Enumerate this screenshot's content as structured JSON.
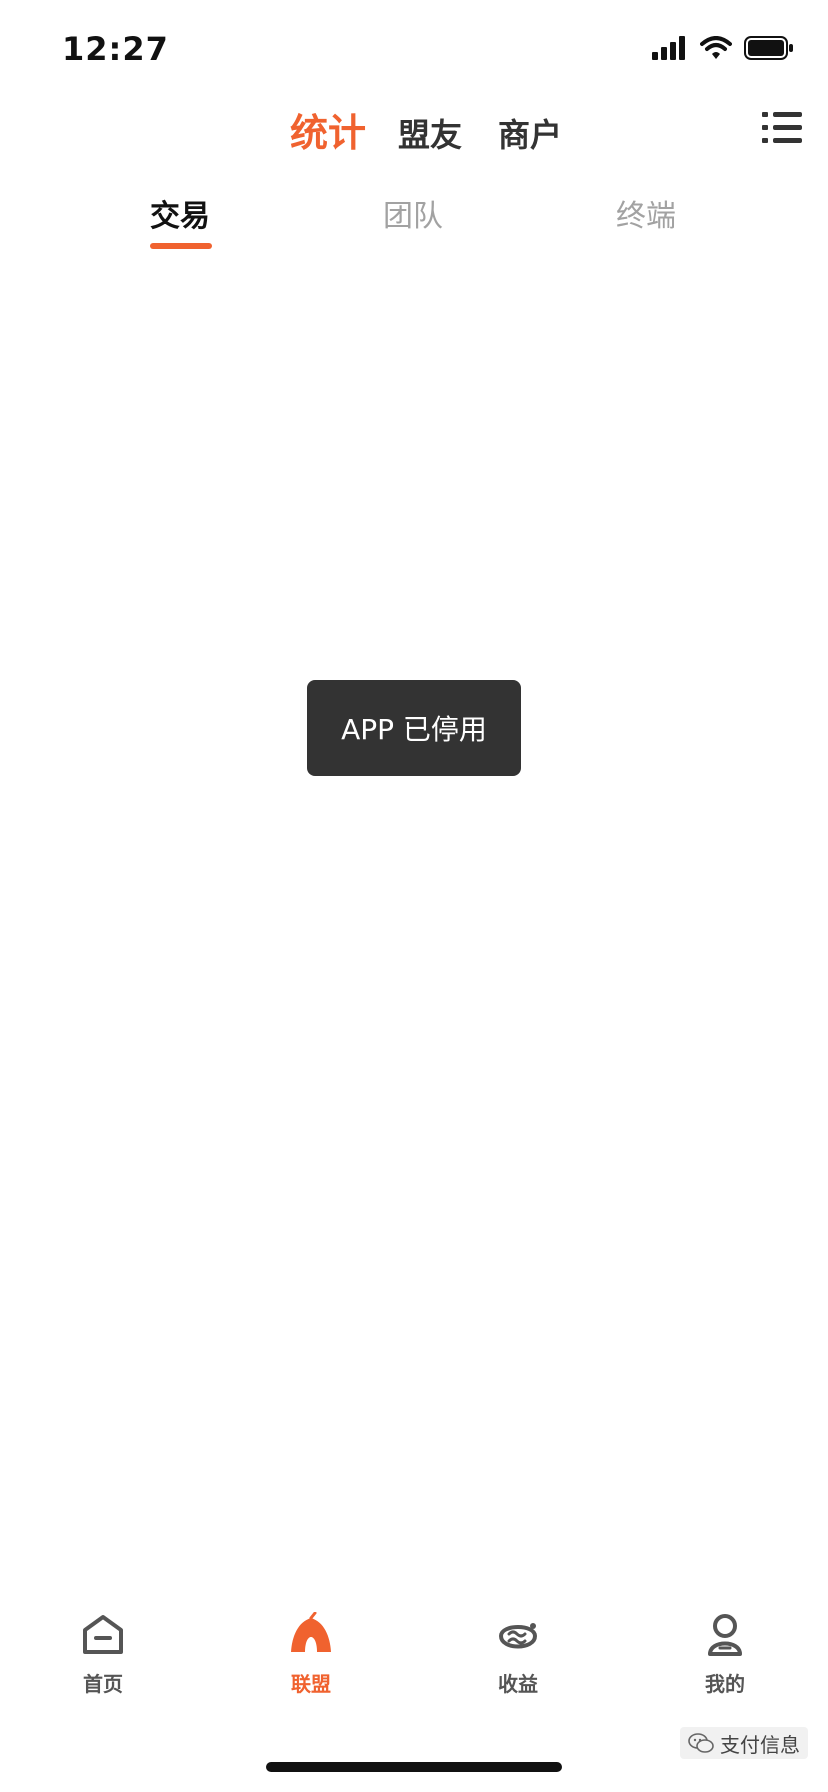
{
  "status_bar": {
    "time": "12:27",
    "icons": [
      "signal-icon",
      "wifi-icon",
      "battery-icon"
    ]
  },
  "top_nav": {
    "tabs": [
      {
        "label": "统计",
        "active": true
      },
      {
        "label": "盟友",
        "active": false
      },
      {
        "label": "商户",
        "active": false
      }
    ],
    "menu_icon": "list-menu-icon"
  },
  "sub_tabs": [
    {
      "label": "交易",
      "active": true
    },
    {
      "label": "团队",
      "active": false
    },
    {
      "label": "终端",
      "active": false
    }
  ],
  "toast": {
    "message": "APP 已停用"
  },
  "tab_bar": {
    "items": [
      {
        "label": "首页",
        "icon": "home-icon",
        "active": false
      },
      {
        "label": "联盟",
        "icon": "alliance-tent-icon",
        "active": true
      },
      {
        "label": "收益",
        "icon": "earnings-icon",
        "active": false
      },
      {
        "label": "我的",
        "icon": "profile-icon",
        "active": false
      }
    ]
  },
  "watermark": {
    "text": "支付信息"
  },
  "colors": {
    "accent": "#f0622f",
    "text_primary": "#111111",
    "text_inactive": "#a2a2a2",
    "toast_bg": "#333333"
  }
}
